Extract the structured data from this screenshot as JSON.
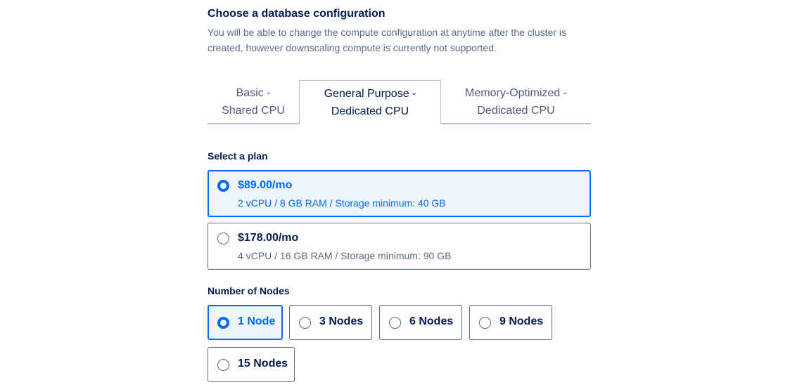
{
  "config": {
    "heading": "Choose a database configuration",
    "subtext": "You will be able to change the compute configuration at anytime after the cluster is created, however downscaling compute is currently not supported."
  },
  "tabs": [
    {
      "line1": "Basic -",
      "line2": "Shared CPU",
      "active": false
    },
    {
      "line1": "General Purpose -",
      "line2": "Dedicated CPU",
      "active": true
    },
    {
      "line1": "Memory-Optimized -",
      "line2": "Dedicated CPU",
      "active": false
    }
  ],
  "plan_section": {
    "label": "Select a plan",
    "plans": [
      {
        "price": "$89.00/mo",
        "spec": "2 vCPU / 8 GB RAM / Storage minimum: 40 GB",
        "selected": true
      },
      {
        "price": "$178.00/mo",
        "spec": "4 vCPU / 16 GB RAM / Storage minimum: 90 GB",
        "selected": false
      }
    ]
  },
  "nodes_section": {
    "label": "Number of Nodes",
    "options": [
      {
        "label": "1 Node",
        "selected": true
      },
      {
        "label": "3 Nodes",
        "selected": false
      },
      {
        "label": "6 Nodes",
        "selected": false
      },
      {
        "label": "9 Nodes",
        "selected": false
      },
      {
        "label": "15 Nodes",
        "selected": false
      }
    ]
  },
  "colors": {
    "accent": "#0069ff",
    "selected_bg": "#eef5ff",
    "text_primary": "#031b4e",
    "text_secondary": "#5b6987",
    "border": "#b5bfd0"
  },
  "icons": {
    "radio_selected": "radio-selected-icon",
    "radio_unselected": "radio-unselected-icon"
  }
}
